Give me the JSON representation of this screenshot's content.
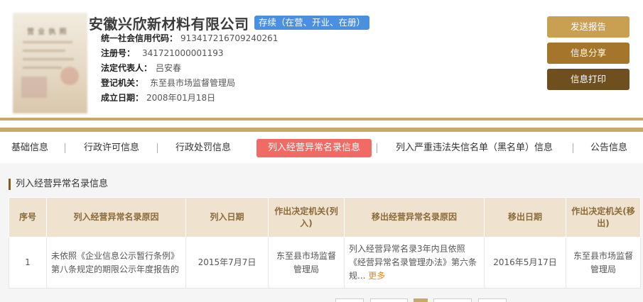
{
  "company": {
    "name": "安徽兴欣新材料有限公司",
    "status": "存续（在营、开业、在册）"
  },
  "info": [
    {
      "label": "统一社会信用代码：",
      "value": "913417216709240261"
    },
    {
      "label": "注册号：",
      "value": "341721000001193"
    },
    {
      "label": "法定代表人：",
      "value": "吕安春"
    },
    {
      "label": "登记机关：",
      "value": "东至县市场监督管理局"
    },
    {
      "label": "成立日期：",
      "value": "2008年01月18日"
    }
  ],
  "actions": {
    "send_report": "发送报告",
    "share_info": "信息分享",
    "print_info": "信息打印"
  },
  "colors": {
    "send_report": "#c9a052",
    "share_info": "#a5752c",
    "print_info": "#6e4f1d",
    "accent": "#c9a96a",
    "active_tab": "#ef6b63",
    "status_badge": "#4a8fe0"
  },
  "tabs": [
    {
      "label": "基础信息"
    },
    {
      "label": "行政许可信息"
    },
    {
      "label": "行政处罚信息"
    },
    {
      "label": "列入经营异常名录信息"
    },
    {
      "label": "列入严重违法失信名单（黑名单）信息"
    },
    {
      "label": "公告信息"
    }
  ],
  "section": {
    "title": "列入经营异常名录信息"
  },
  "table": {
    "headers": [
      "序号",
      "列入经营异常名录原因",
      "列入日期",
      "作出决定机关(列入)",
      "移出经营异常名录原因",
      "移出日期",
      "作出决定机关(移出)"
    ],
    "rows": [
      {
        "index": "1",
        "reason_in": "未依照《企业信息公示暂行条例》第八条规定的期限公示年度报告的",
        "date_in": "2015年7月7日",
        "authority_in": "东至县市场监督管理局",
        "reason_out": "列入经营异常名录3年内且依照《经营异常名录管理办法》第六条规...",
        "more": "更多",
        "date_out": "2016年5月17日",
        "authority_out": "东至县市场监督管理局"
      }
    ]
  }
}
